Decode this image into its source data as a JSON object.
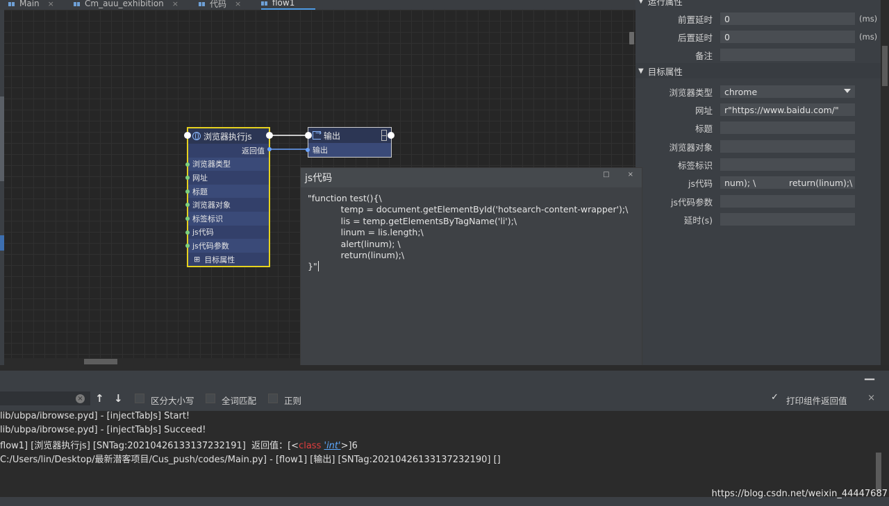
{
  "tabs": [
    {
      "label": "Main",
      "active": false
    },
    {
      "label": "Cm_auu_exhibition",
      "active": false
    },
    {
      "label": "代码",
      "active": false
    },
    {
      "label": "flow1",
      "active": true
    }
  ],
  "tab_close_glyph": "×",
  "node1": {
    "title": "浏览器执行js",
    "return_label": "返回值",
    "rows": [
      "浏览器类型",
      "网址",
      "标题",
      "浏览器对象",
      "标签标识",
      "js代码",
      "js代码参数"
    ],
    "footer": "目标属性",
    "footer_icon": "⊞"
  },
  "node2": {
    "title": "输出",
    "input_label": "输出"
  },
  "popup": {
    "title": "js代码",
    "btn_restore": "□",
    "btn_close": "×",
    "code_lines": [
      "\"function test(){\\",
      "            temp = document.getElementById('hotsearch-content-wrapper');\\",
      "            lis = temp.getElementsByTagName('li');\\",
      "            linum = lis.length;\\",
      "            alert(linum); \\",
      "            return(linum);\\",
      "}\""
    ]
  },
  "props": {
    "section_run": "运行属性",
    "pre_delay_label": "前置延时",
    "pre_delay_value": "0",
    "post_delay_label": "后置延时",
    "post_delay_value": "0",
    "unit": "(ms)",
    "remark_label": "备注",
    "remark_value": "",
    "section_target": "目标属性",
    "section_arrow": "▼",
    "browser_type_label": "浏览器类型",
    "browser_type_value": "chrome",
    "url_label": "网址",
    "url_value": "r\"https://www.baidu.com/\"",
    "title_label": "标题",
    "title_value": "",
    "browser_obj_label": "浏览器对象",
    "browser_obj_value": "",
    "tag_label": "标签标识",
    "tag_value": "",
    "js_label": "js代码",
    "js_value": "num); \\            return(linum);\\ }\"",
    "js_param_label": "js代码参数",
    "js_param_value": "",
    "delay_label": "延时(s)",
    "delay_value": ""
  },
  "toolbar": {
    "clear_glyph": "×",
    "up_glyph": "↑",
    "down_glyph": "↓",
    "case_label": "区分大小写",
    "word_label": "全词匹配",
    "regex_label": "正则",
    "print_label": "打印组件返回值",
    "check_glyph": "✓",
    "close_glyph": "×",
    "minimize_glyph": "—"
  },
  "console": {
    "line1": "lib/ubpa/ibrowse.pyd] - [injectTabJs] Start!",
    "line2": "lib/ubpa/ibrowse.pyd] - [injectTabJs] Succeed!",
    "line3_pre": "flow1] [浏览器执行js] [SNTag:20210426133137232191]  返回值：[<",
    "line3_class": "class",
    "line3_int": "'int'",
    "line3_post": ">]6",
    "line4": "C:/Users/lin/Desktop/最新潜客项目/Cus_push/codes/Main.py] - [flow1] [输出] [SNTag:20210426133137232190] []"
  },
  "watermark": "https://blog.csdn.net/weixin_44447687"
}
